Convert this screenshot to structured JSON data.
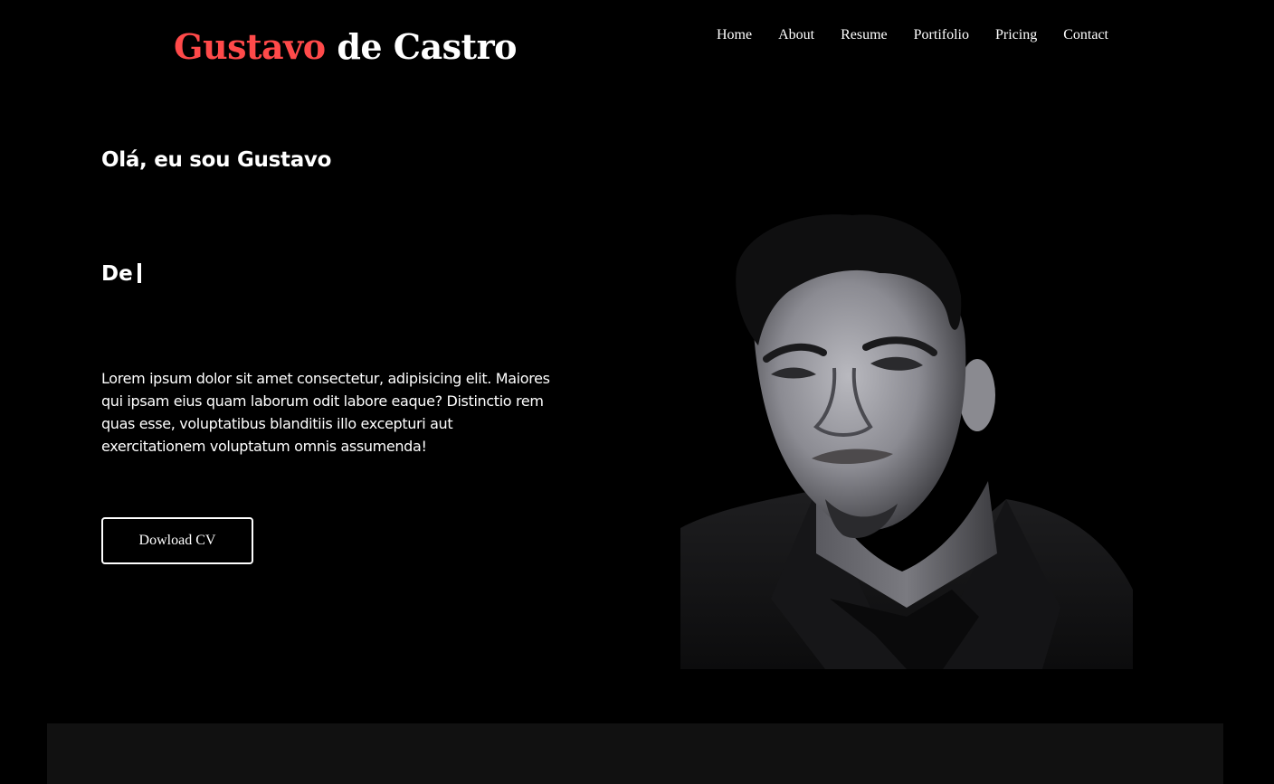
{
  "brand": {
    "first": "Gustavo",
    "rest": "de Castro",
    "accent_color": "#ff4a4a"
  },
  "nav": {
    "items": [
      "Home",
      "About",
      "Resume",
      "Portifolio",
      "Pricing",
      "Contact"
    ]
  },
  "hero": {
    "greeting": "Olá, eu sou Gustavo",
    "typed_text": "De",
    "bio": "Lorem ipsum dolor sit amet consectetur, adipisicing elit. Maiores qui ipsam eius quam laborum odit labore eaque? Distinctio rem quas esse, voluptatibus blanditiis illo excepturi aut exercitationem voluptatum omnis assumenda!",
    "cv_button": "Dowload CV"
  },
  "colors": {
    "background": "#000000",
    "text": "#ffffff",
    "section_band": "#111111"
  }
}
